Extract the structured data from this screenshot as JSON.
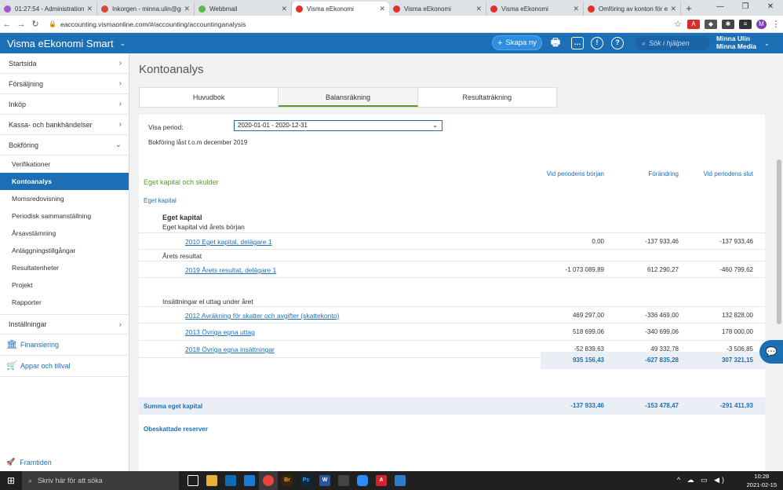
{
  "browser": {
    "tabs": [
      {
        "title": "01:27:54 - Administration -",
        "color": "#a855c9"
      },
      {
        "title": "Inkorgen - minna.ulin@gm",
        "color": "#d44638"
      },
      {
        "title": "Webbmail",
        "color": "#5fb84f"
      },
      {
        "title": "Visma eEkonomi",
        "color": "#e2312d"
      },
      {
        "title": "Visma eEkonomi",
        "color": "#e2312d"
      },
      {
        "title": "Visma eEkonomi",
        "color": "#e2312d"
      },
      {
        "title": "Omföring av konton för eg",
        "color": "#e2312d"
      }
    ],
    "active_tab": 3,
    "url": "eaccounting.vismaonline.com/#/accounting/accountinganalysis",
    "profile_initial": "M"
  },
  "header": {
    "app_title": "Visma eEkonomi Smart",
    "create_button": "Skapa ny",
    "search_placeholder": "Sök i hjälpen",
    "user_name": "Minna Ulin",
    "company": "Minna Media"
  },
  "sidebar": {
    "items": [
      {
        "label": "Startsida"
      },
      {
        "label": "Försäljning"
      },
      {
        "label": "Inköp"
      },
      {
        "label": "Kassa- och bankhändelser"
      },
      {
        "label": "Bokföring"
      }
    ],
    "sub_items": [
      {
        "label": "Verifikationer"
      },
      {
        "label": "Kontoanalys"
      },
      {
        "label": "Momsredovisning"
      },
      {
        "label": "Periodisk sammanställning"
      },
      {
        "label": "Årsavstämning"
      },
      {
        "label": "Anläggningstillgångar"
      },
      {
        "label": "Resultatenheter"
      },
      {
        "label": "Projekt"
      },
      {
        "label": "Rapporter"
      }
    ],
    "settings": "Inställningar",
    "financing": "Finansiering",
    "apps": "Appar och tillval",
    "future": "Framtiden"
  },
  "main": {
    "title": "Kontoanalys",
    "tabs": [
      "Huvudbok",
      "Balansräkning",
      "Resultaträkning"
    ],
    "active_tab": 1,
    "period_label": "Visa period:",
    "period_value": "2020-01-01 - 2020-12-31",
    "lock_info": "Bokföring låst t.o.m december 2019",
    "columns": [
      "Vid periodens början",
      "Förändring",
      "Vid periodens slut"
    ],
    "section_title": "Eget kapital och skulder",
    "group_title": "Eget kapital",
    "subheading": "Eget kapital",
    "rows_labels": {
      "start": "Eget kapital vid årets början",
      "result": "Årets resultat",
      "withdrawals": "Insättningar el uttag under året"
    },
    "accounts": [
      {
        "name": "2010 Eget kapital, delägare 1",
        "start": "0,00",
        "change": "-137 933,46",
        "end": "-137 933,46"
      },
      {
        "name": "2019 Årets resultat, delägare 1",
        "start": "-1 073 089,89",
        "change": "612 290,27",
        "end": "-460 799,62"
      },
      {
        "name": "2012 Avräkning för skatter och avgifter (skattekonto)",
        "start": "469 297,00",
        "change": "-336 469,00",
        "end": "132 828,00"
      },
      {
        "name": "2013 Övriga egna uttag",
        "start": "518 699,06",
        "change": "-340 699,06",
        "end": "178 000,00"
      },
      {
        "name": "2018 Övriga egna insättningar",
        "start": "-52 839,63",
        "change": "49 332,78",
        "end": "-3 506,85"
      }
    ],
    "subtotal": {
      "start": "935 156,43",
      "change": "-627 835,28",
      "end": "307 321,15"
    },
    "sum_label": "Summa eget kapital",
    "sum": {
      "start": "-137 933,46",
      "change": "-153 478,47",
      "end": "-291 411,93"
    },
    "next_section": "Obeskattade reserver"
  },
  "taskbar": {
    "search": "Skriv här för att söka",
    "time": "10:28",
    "date": "2021-02-15"
  }
}
